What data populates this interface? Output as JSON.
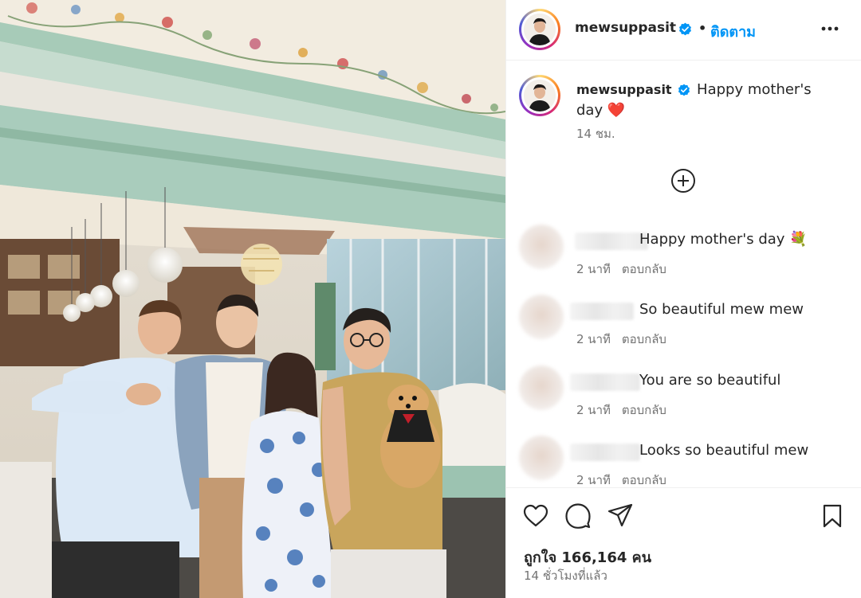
{
  "post": {
    "username": "mewsuppasit",
    "follow_label": "ติดตาม",
    "separator": "•",
    "caption": "Happy mother's day ❤️",
    "caption_time": "14 ชม.",
    "likes": "ถูกใจ 166,164 คน",
    "posted_ago": "14 ชั่วโมงที่แล้ว"
  },
  "comments": [
    {
      "text": "Happy mother's day 💐",
      "time": "2 นาที",
      "reply_label": "ตอบกลับ"
    },
    {
      "text": "So beautiful mew mew",
      "time": "2 นาที",
      "reply_label": "ตอบกลับ"
    },
    {
      "text": "You are so beautiful",
      "time": "2 นาที",
      "reply_label": "ตอบกลับ"
    },
    {
      "text": "Looks so beautiful mew",
      "time": "2 นาที",
      "reply_label": "ตอบกลับ"
    }
  ],
  "icons": {
    "verified": "verified-badge-icon",
    "more": "more-options-icon",
    "load_more": "plus-circle-icon",
    "like": "heart-icon",
    "comment": "comment-bubble-icon",
    "share": "paper-plane-icon",
    "save": "bookmark-icon"
  },
  "colors": {
    "link_blue": "#0095f6",
    "verified_blue": "#0095f6",
    "muted_text": "#737373",
    "caption_heart": "#e0245e"
  }
}
